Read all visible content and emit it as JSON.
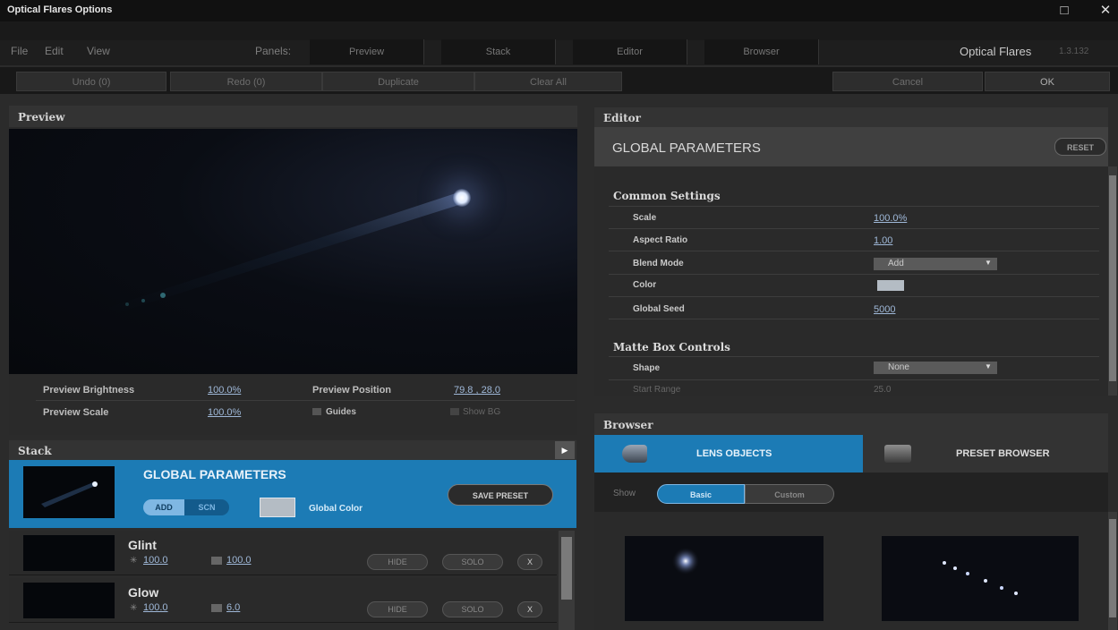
{
  "window": {
    "title": "Optical Flares Options",
    "maximize_icon": "□",
    "close_icon": "✕"
  },
  "menu": {
    "file": "File",
    "edit": "Edit",
    "view": "View",
    "panels_label": "Panels:"
  },
  "panel_tabs": {
    "preview": "Preview",
    "stack": "Stack",
    "editor": "Editor",
    "browser": "Browser"
  },
  "brand": {
    "name": "Optical Flares",
    "version": "1.3.132"
  },
  "actions": {
    "undo": "Undo (0)",
    "redo": "Redo (0)",
    "duplicate": "Duplicate",
    "clear_all": "Clear All",
    "cancel": "Cancel",
    "ok": "OK"
  },
  "preview": {
    "header": "Preview",
    "brightness_label": "Preview Brightness",
    "brightness_value": "100.0%",
    "position_label": "Preview Position",
    "position_value": "79.8 , 28.0",
    "scale_label": "Preview Scale",
    "scale_value": "100.0%",
    "guides_label": "Guides",
    "show_bg_label": "Show BG"
  },
  "stack": {
    "header": "Stack",
    "global": {
      "title": "GLOBAL PARAMETERS",
      "add_label": "ADD",
      "scn_label": "SCN",
      "global_color_label": "Global Color",
      "save_preset": "SAVE PRESET"
    },
    "layers": [
      {
        "name": "Glint",
        "brightness": "100.0",
        "scale": "100.0",
        "hide": "HIDE",
        "solo": "SOLO",
        "remove": "X"
      },
      {
        "name": "Glow",
        "brightness": "100.0",
        "scale": "6.0",
        "hide": "HIDE",
        "solo": "SOLO",
        "remove": "X"
      }
    ]
  },
  "editor": {
    "header": "Editor",
    "section_title": "GLOBAL PARAMETERS",
    "reset": "RESET",
    "common": {
      "title": "Common Settings",
      "scale_label": "Scale",
      "scale_value": "100.0%",
      "aspect_label": "Aspect Ratio",
      "aspect_value": "1.00",
      "blend_label": "Blend Mode",
      "blend_value": "Add",
      "color_label": "Color",
      "seed_label": "Global Seed",
      "seed_value": "5000"
    },
    "matte": {
      "title": "Matte Box Controls",
      "shape_label": "Shape",
      "shape_value": "None",
      "start_range_label": "Start Range",
      "start_range_value": "25.0"
    }
  },
  "browser": {
    "header": "Browser",
    "lens_objects": "LENS OBJECTS",
    "preset_browser": "PRESET BROWSER",
    "show_label": "Show",
    "basic": "Basic",
    "custom": "Custom"
  },
  "colors": {
    "accent_blue": "#1c7bb5",
    "panel_bg": "#2a2a2a",
    "link_blue": "#9fb8d8"
  },
  "icons": [
    "sun-icon",
    "scale-icon",
    "checkbox-icon",
    "dropdown-arrow-icon",
    "lens-object-icon",
    "preset-browser-icon"
  ]
}
